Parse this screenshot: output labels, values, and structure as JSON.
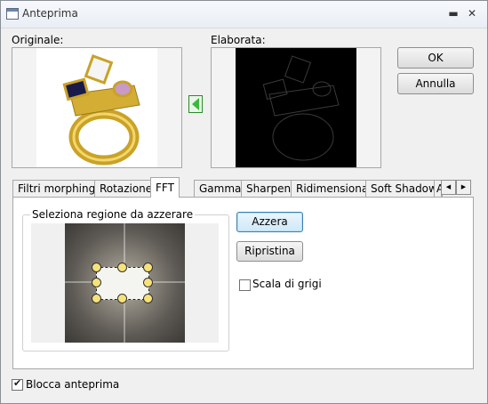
{
  "window": {
    "title": "Anteprima"
  },
  "titlebar": {
    "minimize": "▬",
    "close": "✕"
  },
  "labels": {
    "original": "Originale:",
    "processed": "Elaborata:"
  },
  "buttons": {
    "ok": "OK",
    "cancel": "Annulla",
    "reset_region": "Azzera",
    "restore": "Ripristina"
  },
  "tabs": [
    {
      "label": "Filtri morphing",
      "active": false
    },
    {
      "label": "Rotazione",
      "active": false
    },
    {
      "label": "FFT",
      "active": true
    },
    {
      "label": "Gamma",
      "active": false
    },
    {
      "label": "Sharpen",
      "active": false
    },
    {
      "label": "Ridimensiona",
      "active": false
    },
    {
      "label": "Soft Shadow",
      "active": false
    },
    {
      "label": "A",
      "active": false
    }
  ],
  "tab_scroll": {
    "left": "◀",
    "right": "▶"
  },
  "fft": {
    "group_label": "Seleziona regione da azzerare",
    "grayscale_label": "Scala di grigi",
    "grayscale_checked": false
  },
  "footer": {
    "lock_preview_label": "Blocca anteprima",
    "lock_preview_checked": true
  },
  "colors": {
    "accent_arrow": "#3cb83c",
    "focus_border": "#3c7fb1"
  }
}
